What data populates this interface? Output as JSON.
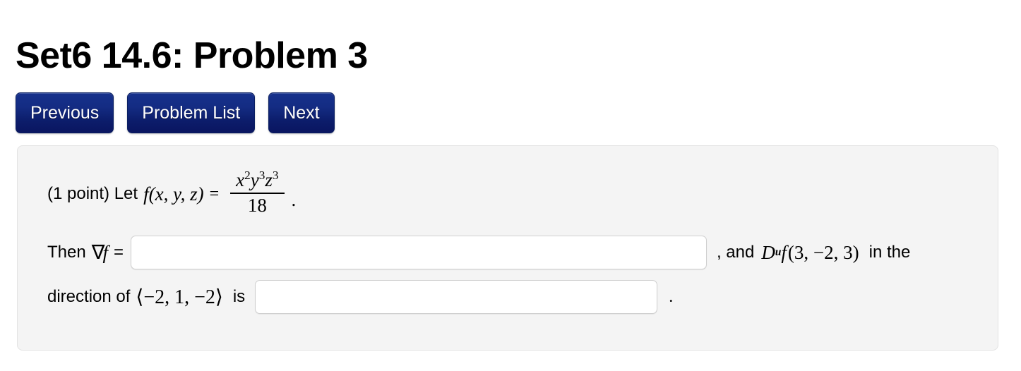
{
  "page": {
    "title": "Set6 14.6: Problem 3",
    "background": "#ffffff"
  },
  "nav": {
    "buttons": [
      {
        "label": "Previous",
        "name": "previous-button"
      },
      {
        "label": "Problem List",
        "name": "problem-list-button"
      },
      {
        "label": "Next",
        "name": "next-button"
      }
    ],
    "color": "#13267f"
  },
  "panel": {
    "background": "#f4f4f4",
    "border_color": "#e3e3e3",
    "line1": {
      "points_text": "(1 point) Let",
      "function_name": "f",
      "arguments": "(x, y, z)",
      "equals": "=",
      "fraction": {
        "numerator_base": [
          "x",
          "y",
          "z"
        ],
        "numerator_exponents": [
          "2",
          "3",
          "3"
        ],
        "numerator_display": "x^2 y^3 z^3",
        "denominator": "18"
      },
      "trailing_punctuation": "."
    },
    "line2": {
      "prefix": "Then",
      "nabla_symbol": "∇",
      "nabla_function": "f",
      "equals": "=",
      "input_value": "",
      "input_placeholder": "",
      "suffix_text": ", and",
      "directional_derivative": {
        "symbol": "D",
        "subscript": "u",
        "function": "f",
        "point": "(3, −2, 3)"
      },
      "suffix_tail": "in the"
    },
    "line3": {
      "prefix": "direction of",
      "vector": "⟨−2, 1, −2⟩",
      "is_word": "is",
      "input_value": "",
      "input_placeholder": "",
      "trailing_punctuation": "."
    }
  }
}
